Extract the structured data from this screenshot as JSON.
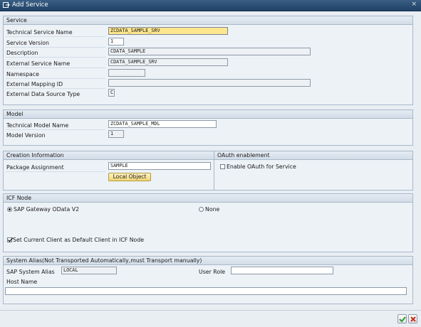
{
  "window": {
    "title": "Add Service",
    "close_glyph": "×"
  },
  "service": {
    "header": "Service",
    "technical_service_name": {
      "label": "Technical Service Name",
      "value": "ZCDATA_SAMPLE_SRV"
    },
    "service_version": {
      "label": "Service Version",
      "value": "1"
    },
    "description": {
      "label": "Description",
      "value": "CDATA_SAMPLE"
    },
    "external_service_name": {
      "label": "External Service Name",
      "value": "CDATA_SAMPLE_SRV"
    },
    "namespace": {
      "label": "Namespace",
      "value": ""
    },
    "external_mapping_id": {
      "label": "External Mapping ID",
      "value": ""
    },
    "external_data_source_type": {
      "label": "External Data Source Type",
      "value": "C"
    }
  },
  "model": {
    "header": "Model",
    "technical_model_name": {
      "label": "Technical Model Name",
      "value": "ZCDATA_SAMPLE_MDL"
    },
    "model_version": {
      "label": "Model Version",
      "value": "1"
    }
  },
  "creation": {
    "header": "Creation Information",
    "package_assignment": {
      "label": "Package Assignment",
      "value": "SAMPLE"
    },
    "local_object_button": "Local Object"
  },
  "oauth": {
    "header": "OAuth enablement",
    "enable_label": "Enable OAuth for Service",
    "checked": false
  },
  "icf": {
    "header": "ICF Node",
    "option_gateway": "SAP Gateway OData V2",
    "option_none": "None",
    "selected": "SAP Gateway OData V2",
    "default_client_label": "Set Current Client as Default Client in ICF Node",
    "default_client_checked": true
  },
  "alias": {
    "header": "System Alias(Not Transported Automatically,must Transport manually)",
    "sap_system_alias": {
      "label": "SAP System Alias",
      "value": "LOCAL"
    },
    "user_role": {
      "label": "User Role",
      "value": ""
    },
    "host_name": {
      "label": "Host Name",
      "value": ""
    }
  },
  "footer": {
    "ok_icon": "green-check-icon",
    "cancel_icon": "red-x-icon"
  },
  "colors": {
    "titlebar": "#2b4f76",
    "highlight_field": "#fde68e",
    "button": "#f2d674",
    "ok_green": "#2f9a2f",
    "cancel_red": "#cc2a1a"
  }
}
